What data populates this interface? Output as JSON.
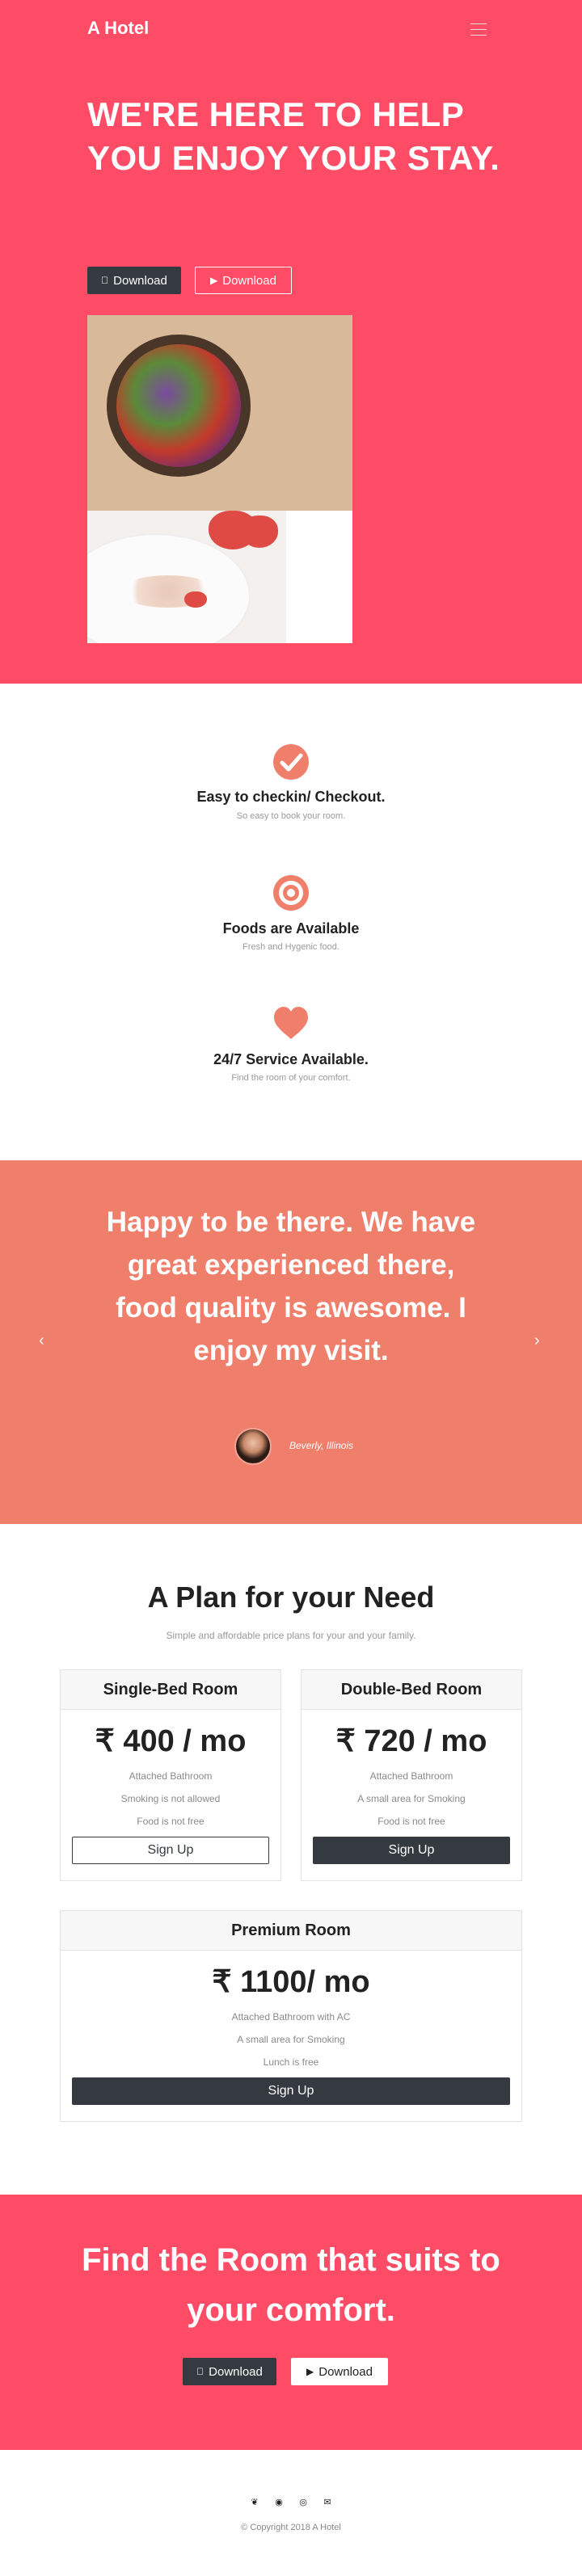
{
  "nav": {
    "brand": "A Hotel"
  },
  "hero": {
    "title": "WE'RE HERE TO HELP YOU ENJOY YOUR STAY.",
    "download_primary": "Download",
    "download_secondary": "Download"
  },
  "features": [
    {
      "icon": "check-circle-icon",
      "title": "Easy to checkin/ Checkout.",
      "desc": "So easy to book your room."
    },
    {
      "icon": "target-icon",
      "title": "Foods are Available",
      "desc": "Fresh and Hygenic food."
    },
    {
      "icon": "heart-icon",
      "title": "24/7 Service Available.",
      "desc": "Find the room of your comfort."
    }
  ],
  "testimonial": {
    "quote": "Happy to be there. We have great experienced there, food quality is awesome. I enjoy my visit.",
    "author": "Beverly, Illinois"
  },
  "pricing": {
    "title": "A Plan for your Need",
    "subtitle": "Simple and affordable price plans for your and your family.",
    "plans": [
      {
        "name": "Single-Bed Room",
        "price": "₹ 400 / mo",
        "features": [
          "Attached Bathroom",
          "Smoking is not allowed",
          "Food is not free"
        ],
        "button": "Sign Up"
      },
      {
        "name": "Double-Bed Room",
        "price": "₹ 720 / mo",
        "features": [
          "Attached Bathroom",
          "A small area for Smoking",
          "Food is not free"
        ],
        "button": "Sign Up"
      },
      {
        "name": "Premium Room",
        "price": "₹ 1100/ mo",
        "features": [
          "Attached Bathroom with AC",
          "A small area for Smoking",
          "Lunch is free"
        ],
        "button": "Sign Up"
      }
    ]
  },
  "cta": {
    "title": "Find the Room that suits to your comfort.",
    "download_primary": "Download",
    "download_secondary": "Download"
  },
  "footer": {
    "social_icons": [
      "twitter-icon",
      "facebook-icon",
      "instagram-icon",
      "email-icon"
    ],
    "copyright": "© Copyright 2018 A Hotel"
  },
  "colors": {
    "hero_bg": "#fe4c66",
    "accent": "#ef7f6b",
    "dark_button": "#343a40"
  }
}
